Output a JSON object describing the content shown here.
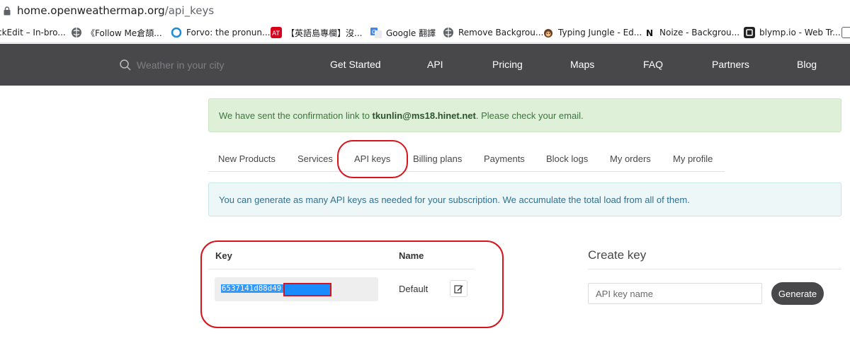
{
  "browser": {
    "url_host": "home.openweathermap.org",
    "url_path": "/api_keys",
    "bookmarks": [
      {
        "label": "ckEdit – In-bro...",
        "icon": "none"
      },
      {
        "label": "《Follow Me倉頡...",
        "icon": "globe-icon"
      },
      {
        "label": "Forvo: the pronun...",
        "icon": "forvo-icon"
      },
      {
        "label": "【英語島專欄】沒...",
        "icon": "acrobat-icon"
      },
      {
        "label": "Google 翻譯",
        "icon": "google-translate-icon"
      },
      {
        "label": "Remove Backgrou...",
        "icon": "globe-icon"
      },
      {
        "label": "Typing Jungle - Ed...",
        "icon": "monkey-icon"
      },
      {
        "label": "Noize - Backgrou...",
        "icon": "noize-icon"
      },
      {
        "label": "blymp.io - Web Tr...",
        "icon": "blymp-icon"
      }
    ]
  },
  "nav": {
    "search_placeholder": "Weather in your city",
    "links": [
      "Get Started",
      "API",
      "Pricing",
      "Maps",
      "FAQ",
      "Partners",
      "Blog"
    ]
  },
  "confirmation": {
    "prefix": "We have sent the confirmation link to ",
    "email": "tkunlin@ms18.hinet.net",
    "suffix": ". Please check your email."
  },
  "tabs": [
    "New Products",
    "Services",
    "API keys",
    "Billing plans",
    "Payments",
    "Block logs",
    "My orders",
    "My profile"
  ],
  "info_text": "You can generate as many API keys as needed for your subscription. We accumulate the total load from all of them.",
  "keys_table": {
    "col_key": "Key",
    "col_name": "Name",
    "rows": [
      {
        "key": "6537141d88d49             2252a1f5",
        "name": "Default"
      }
    ]
  },
  "create_key": {
    "title": "Create key",
    "placeholder": "API key name",
    "button": "Generate"
  },
  "colors": {
    "nav_bg": "#48484a",
    "success_bg": "#dff0d8",
    "info_bg": "#eef7f8",
    "annotation": "#d7131b",
    "selection": "#3399ff"
  }
}
